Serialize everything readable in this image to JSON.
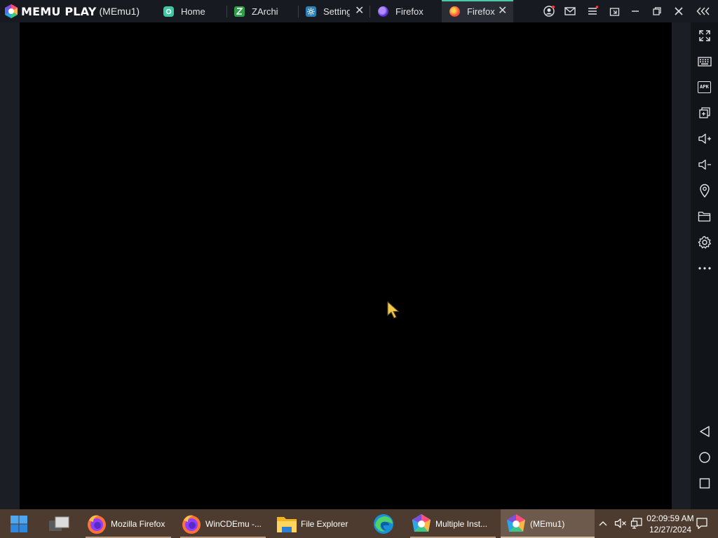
{
  "window": {
    "brand": "MEMU PLAY",
    "instance": "(MEmu1)"
  },
  "tabs": [
    {
      "label": "Home",
      "icon": "home-app-icon",
      "color": "#3ec7a5"
    },
    {
      "label": "ZArchiv",
      "icon": "zarchiver-icon",
      "color": "#2e9e4a"
    },
    {
      "label": "Setting",
      "icon": "settings-gear-icon",
      "color": "#2f7fb6"
    },
    {
      "label": "Firefox",
      "icon": "firefox-icon",
      "color": "#7542e5"
    },
    {
      "label": "Firefox",
      "icon": "firefox-icon",
      "color": "#ff5a36",
      "active": true
    }
  ],
  "toolbar": {
    "items": [
      "fullscreen-icon",
      "keyboard-icon",
      "apk-icon",
      "multi-window-icon",
      "volume-up-icon",
      "volume-down-icon",
      "location-icon",
      "folder-icon",
      "settings-icon",
      "more-icon",
      "back-icon",
      "home-icon",
      "recents-icon"
    ],
    "apk_text": "APK"
  },
  "taskbar": {
    "items": [
      {
        "label": "",
        "icon": "windows-start-icon"
      },
      {
        "label": "",
        "icon": "task-view-icon"
      },
      {
        "label": "Mozilla Firefox",
        "icon": "firefox-icon"
      },
      {
        "label": "WinCDEmu -...",
        "icon": "firefox-icon"
      },
      {
        "label": "File Explorer",
        "icon": "folder-icon"
      },
      {
        "label": "",
        "icon": "edge-icon"
      },
      {
        "label": "Multiple Inst...",
        "icon": "memu-multi-icon"
      },
      {
        "label": "(MEmu1)",
        "icon": "memu-icon",
        "active": true
      }
    ],
    "clock": {
      "time": "02:09:59 AM",
      "date": "12/27/2024"
    }
  },
  "colors": {
    "titlebar": "#171a21",
    "accent": "#49c9a6",
    "taskbar": "#4c3b2e"
  }
}
